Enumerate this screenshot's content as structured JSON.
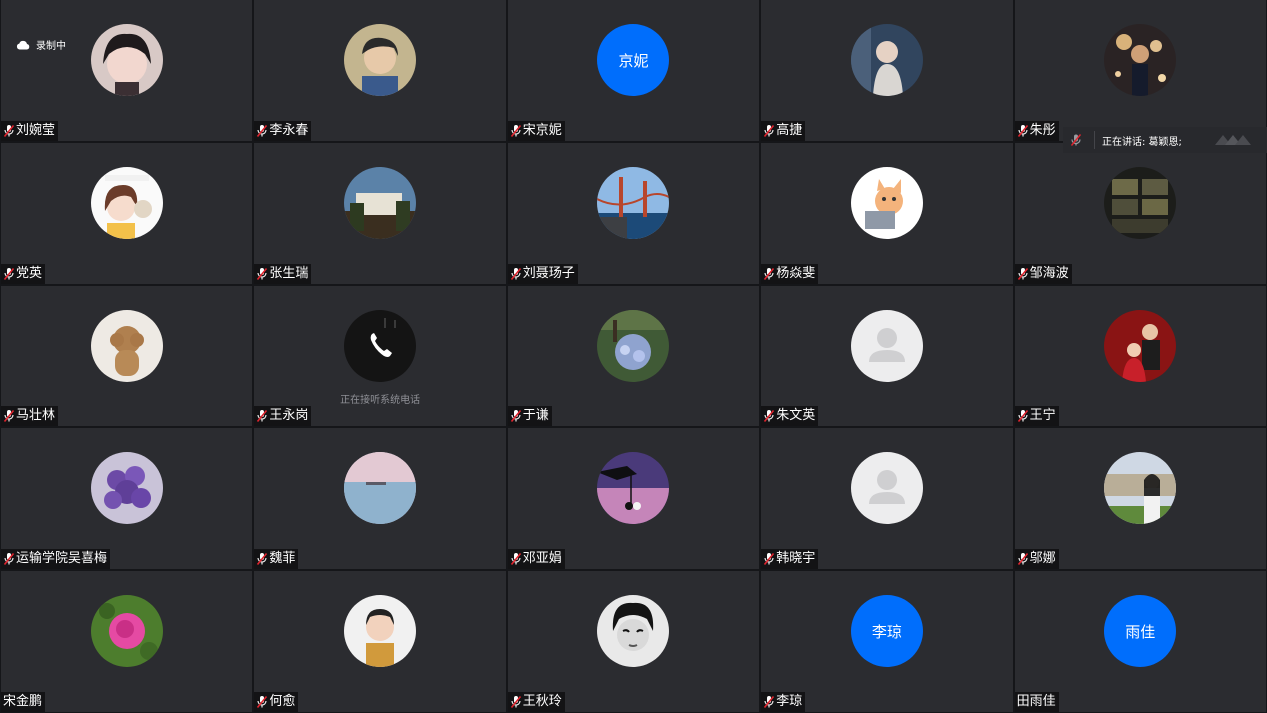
{
  "recording": {
    "label": "录制中",
    "icon": "cloud-record-icon"
  },
  "speaking": {
    "label": "正在讲话: 葛颖恩;"
  },
  "calling_status": "正在接听系统电话",
  "colors": {
    "tile_bg": "#2b2c30",
    "initials_bg": "#006efc",
    "mic_red": "#e0242e"
  },
  "participants": [
    {
      "name": "刘婉莹",
      "muted": true,
      "avatar": "anime-girl-photo"
    },
    {
      "name": "李永春",
      "muted": true,
      "avatar": "cartoon-man-photo"
    },
    {
      "name": "宋京妮",
      "muted": true,
      "avatar": "initials",
      "initials": "京妮"
    },
    {
      "name": "高捷",
      "muted": true,
      "avatar": "person-photo"
    },
    {
      "name": "朱彤",
      "muted": true,
      "avatar": "sparkle-photo"
    },
    {
      "name": "党英",
      "muted": true,
      "avatar": "cartoon-girl-photo"
    },
    {
      "name": "张生瑞",
      "muted": true,
      "avatar": "building-photo"
    },
    {
      "name": "刘聂玚子",
      "muted": true,
      "avatar": "bridge-photo"
    },
    {
      "name": "杨焱斐",
      "muted": true,
      "avatar": "cartoon-cat-photo"
    },
    {
      "name": "邹海波",
      "muted": true,
      "avatar": "cassette-photo"
    },
    {
      "name": "马壮林",
      "muted": true,
      "avatar": "poodle-photo"
    },
    {
      "name": "王永岗",
      "muted": true,
      "avatar": "phone-call",
      "status": "正在接听系统电话"
    },
    {
      "name": "于谦",
      "muted": true,
      "avatar": "garden-photo"
    },
    {
      "name": "朱文英",
      "muted": true,
      "avatar": "default-person"
    },
    {
      "name": "王宁",
      "muted": true,
      "avatar": "couple-photo"
    },
    {
      "name": "运输学院吴喜梅",
      "muted": true,
      "avatar": "flowers-photo"
    },
    {
      "name": "魏菲",
      "muted": true,
      "avatar": "sea-photo"
    },
    {
      "name": "邓亚娟",
      "muted": true,
      "avatar": "hand-cherry-photo"
    },
    {
      "name": "韩晓宇",
      "muted": true,
      "avatar": "default-person"
    },
    {
      "name": "邬娜",
      "muted": true,
      "avatar": "campus-photo"
    },
    {
      "name": "宋金鹏",
      "muted": false,
      "avatar": "rose-photo"
    },
    {
      "name": "何愈",
      "muted": true,
      "avatar": "cartoon-boy-photo"
    },
    {
      "name": "王秋玲",
      "muted": true,
      "avatar": "actress-photo"
    },
    {
      "name": "李琼",
      "muted": true,
      "avatar": "initials",
      "initials": "李琼"
    },
    {
      "name": "田雨佳",
      "muted": false,
      "avatar": "initials",
      "initials": "雨佳"
    }
  ]
}
